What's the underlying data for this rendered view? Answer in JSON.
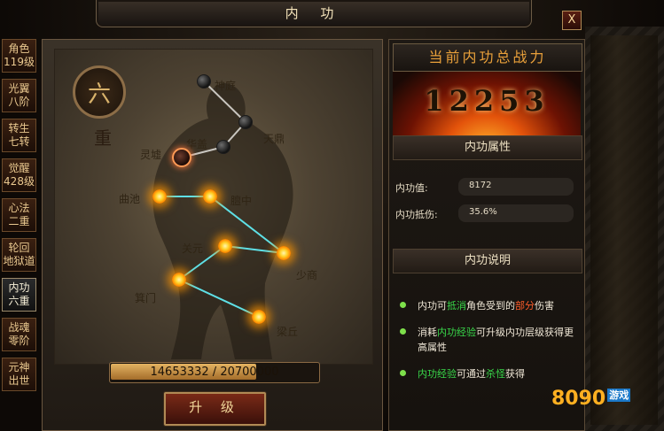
{
  "window": {
    "title": "内 功",
    "close_label": "X"
  },
  "sidebar": {
    "items": [
      {
        "line1": "角色",
        "line2": "119级",
        "active": false
      },
      {
        "line1": "光翼",
        "line2": "八阶",
        "active": false
      },
      {
        "line1": "转生",
        "line2": "七转",
        "active": false
      },
      {
        "line1": "觉醒",
        "line2": "428级",
        "active": false
      },
      {
        "line1": "心法",
        "line2": "二重",
        "active": false
      },
      {
        "line1": "轮回",
        "line2": "地狱道",
        "active": false
      },
      {
        "line1": "内功",
        "line2": "六重",
        "active": true
      },
      {
        "line1": "战魂",
        "line2": "零阶",
        "active": false
      },
      {
        "line1": "元神",
        "line2": "出世",
        "active": false
      }
    ]
  },
  "emblem": {
    "level_char": "六",
    "level_sub": "重"
  },
  "meridians": {
    "nodes": [
      {
        "name": "神庭",
        "state": "dark"
      },
      {
        "name": "天鼎",
        "state": "dark"
      },
      {
        "name": "华盖",
        "state": "dark"
      },
      {
        "name": "灵墟",
        "state": "current"
      },
      {
        "name": "曲池",
        "state": "lit"
      },
      {
        "name": "膻中",
        "state": "lit"
      },
      {
        "name": "关元",
        "state": "lit"
      },
      {
        "name": "少商",
        "state": "lit"
      },
      {
        "name": "箕门",
        "state": "lit"
      },
      {
        "name": "梁丘",
        "state": "lit"
      }
    ]
  },
  "progress": {
    "current": "14653332",
    "max": "20700000",
    "text": "14653332 / 20700000",
    "fraction": 0.7079
  },
  "upgrade_label": "升 级",
  "power": {
    "title": "当前内功总战力",
    "value": "12253"
  },
  "attributes": {
    "title": "内功属性",
    "rows": [
      {
        "label": "内功值:",
        "value": "8172"
      },
      {
        "label": "内功抵伤:",
        "value": "35.6%"
      }
    ]
  },
  "description": {
    "title": "内功说明",
    "items": [
      {
        "parts": [
          {
            "t": "内功可",
            "c": ""
          },
          {
            "t": "抵消",
            "c": "green"
          },
          {
            "t": "角色受到的",
            "c": ""
          },
          {
            "t": "部分",
            "c": "red"
          },
          {
            "t": "伤害",
            "c": ""
          }
        ]
      },
      {
        "parts": [
          {
            "t": "消耗",
            "c": ""
          },
          {
            "t": "内功经验",
            "c": "green"
          },
          {
            "t": "可升级内功层级获得更高属性",
            "c": ""
          }
        ]
      },
      {
        "parts": [
          {
            "t": "内功经验",
            "c": "green"
          },
          {
            "t": "可通过",
            "c": ""
          },
          {
            "t": "杀怪",
            "c": "green"
          },
          {
            "t": "获得",
            "c": ""
          }
        ]
      }
    ]
  },
  "colors": {
    "accent": "#e9a03a",
    "highlight_green": "#39d84a",
    "highlight_red": "#ff5d2a",
    "lit_node": "#ffd129"
  },
  "logo": {
    "main": "8090",
    "sub": "游戏"
  }
}
